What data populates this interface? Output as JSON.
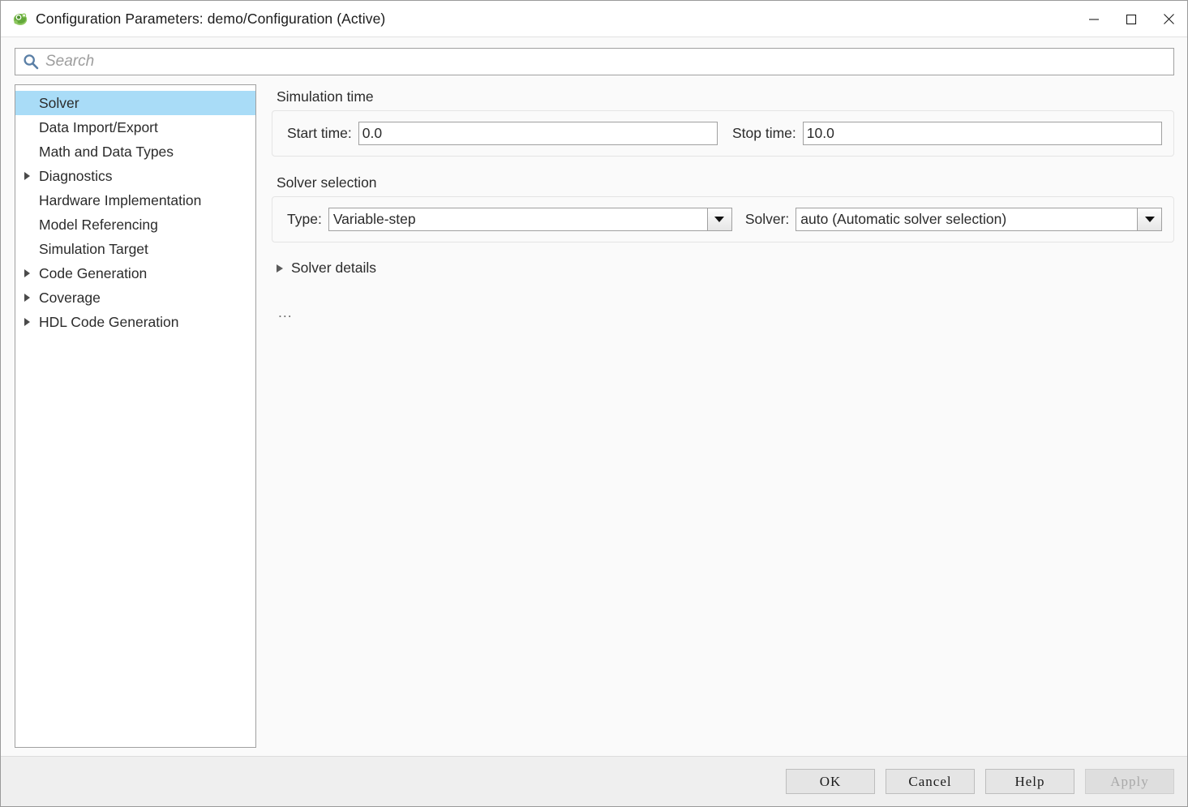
{
  "window": {
    "title": "Configuration Parameters: demo/Configuration (Active)",
    "icon": "simulink-logo-icon",
    "controls": {
      "minimize": "minimize-icon",
      "maximize": "maximize-icon",
      "close": "close-icon"
    }
  },
  "search": {
    "placeholder": "Search",
    "value": "",
    "icon": "search-icon"
  },
  "sidebar": {
    "items": [
      {
        "label": "Solver",
        "expandable": false,
        "selected": true
      },
      {
        "label": "Data Import/Export",
        "expandable": false,
        "selected": false
      },
      {
        "label": "Math and Data Types",
        "expandable": false,
        "selected": false
      },
      {
        "label": "Diagnostics",
        "expandable": true,
        "selected": false
      },
      {
        "label": "Hardware Implementation",
        "expandable": false,
        "selected": false
      },
      {
        "label": "Model Referencing",
        "expandable": false,
        "selected": false
      },
      {
        "label": "Simulation Target",
        "expandable": false,
        "selected": false
      },
      {
        "label": "Code Generation",
        "expandable": true,
        "selected": false
      },
      {
        "label": "Coverage",
        "expandable": true,
        "selected": false
      },
      {
        "label": "HDL Code Generation",
        "expandable": true,
        "selected": false
      }
    ]
  },
  "main": {
    "simulation_time": {
      "title": "Simulation time",
      "start_label": "Start time:",
      "start_value": "0.0",
      "stop_label": "Stop time:",
      "stop_value": "10.0"
    },
    "solver_selection": {
      "title": "Solver selection",
      "type_label": "Type:",
      "type_value": "Variable-step",
      "solver_label": "Solver:",
      "solver_value": "auto (Automatic solver selection)"
    },
    "solver_details": {
      "label": "Solver details",
      "expanded": false
    },
    "overflow_text": "..."
  },
  "footer": {
    "buttons": [
      {
        "label": "OK",
        "enabled": true
      },
      {
        "label": "Cancel",
        "enabled": true
      },
      {
        "label": "Help",
        "enabled": true
      },
      {
        "label": "Apply",
        "enabled": false
      }
    ]
  },
  "colors": {
    "selection": "#a9dcf7",
    "accent_icon": "#5a7fa6",
    "logo_green": "#6aaa38",
    "footer_bg": "#efefef",
    "content_bg": "#fafafa"
  }
}
